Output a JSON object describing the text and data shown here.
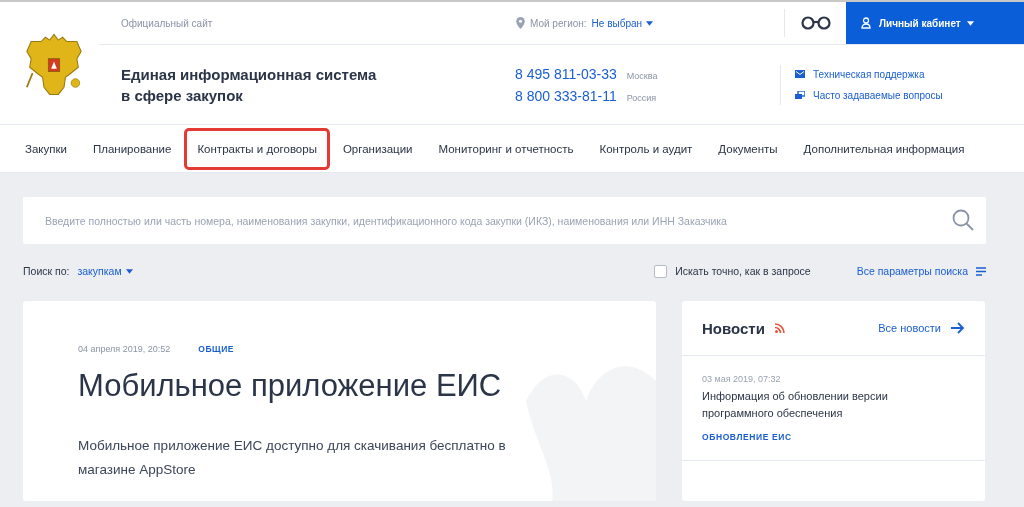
{
  "topbar": {
    "official": "Официальный сайт",
    "region_label": "Мой регион:",
    "region_value": "Не выбран",
    "cabinet": "Личный кабинет"
  },
  "header": {
    "title_line1": "Единая информационная система",
    "title_line2": "в сфере закупок",
    "phones": [
      {
        "number": "8 495 811-03-33",
        "city": "Москва"
      },
      {
        "number": "8 800 333-81-11",
        "city": "Россия"
      }
    ],
    "links": [
      {
        "kind": "support",
        "label": "Техническая поддержка"
      },
      {
        "kind": "faq",
        "label": "Часто задаваемые вопросы"
      }
    ]
  },
  "nav": [
    {
      "label": "Закупки",
      "highlighted": false
    },
    {
      "label": "Планирование",
      "highlighted": false
    },
    {
      "label": "Контракты и договоры",
      "highlighted": true
    },
    {
      "label": "Организации",
      "highlighted": false
    },
    {
      "label": "Мониторинг и отчетность",
      "highlighted": false
    },
    {
      "label": "Контроль и аудит",
      "highlighted": false
    },
    {
      "label": "Документы",
      "highlighted": false
    },
    {
      "label": "Дополнительная информация",
      "highlighted": false
    }
  ],
  "search": {
    "placeholder": "Введите полностью или часть номера, наименования закупки, идентификационного кода закупки (ИКЗ), наименования или ИНН Заказчика",
    "search_by_label": "Поиск по:",
    "search_by_value": "закупкам",
    "exact_label": "Искать точно, как в запросе",
    "exact_checked": false,
    "all_params": "Все параметры поиска"
  },
  "article": {
    "date": "04 апреля 2019, 20:52",
    "tag": "ОБЩИЕ",
    "title": "Мобильное приложение ЕИС",
    "text": "Мобильное приложение ЕИС доступно для скачивания бесплатно в магазине AppStore"
  },
  "news": {
    "title": "Новости",
    "all_link": "Все новости",
    "items": [
      {
        "date": "03 мая 2019, 07:32",
        "title": "Информация об обновлении версии программного обеспечения",
        "tag": "ОБНОВЛЕНИЕ ЕИС"
      }
    ]
  }
}
